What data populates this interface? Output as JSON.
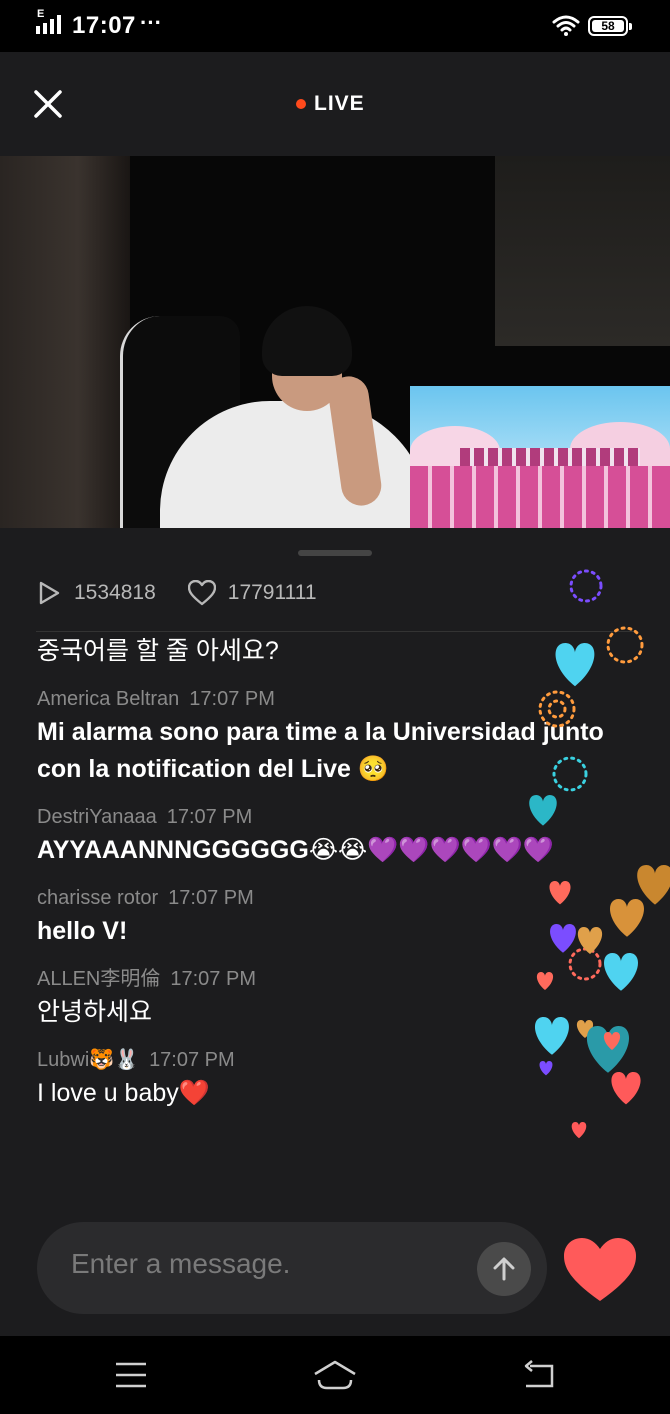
{
  "status_bar": {
    "network_label": "E",
    "time": "17:07",
    "more_dots": "···",
    "battery_level": "58"
  },
  "header": {
    "live_label": "LIVE",
    "accent_color": "#ff4a1c"
  },
  "stats": {
    "plays": "1534818",
    "likes": "17791111"
  },
  "chat": {
    "first_message": "중국어를 할 줄 아세요?",
    "messages": [
      {
        "user": "America Beltran",
        "time": "17:07 PM",
        "text": "Mi alarma sono para time a la Universidad junto con la notification del Live 🥺"
      },
      {
        "user": "DestriYanaaa",
        "time": "17:07 PM",
        "text": "AYYAAANNNGGGGGG😭😭💜💜💜💜💜💜"
      },
      {
        "user": "charisse rotor",
        "time": "17:07 PM",
        "text": "hello V!"
      },
      {
        "user": "ALLEN李明倫",
        "time": "17:07 PM",
        "text": "안녕하세요"
      },
      {
        "user": "Lubwi🐯🐰",
        "time": "17:07 PM",
        "text": "I love u baby❤️"
      }
    ]
  },
  "input": {
    "placeholder": "Enter a message."
  },
  "icons": {
    "close": "close-icon",
    "send": "arrow-up-icon",
    "like": "heart-icon",
    "play": "play-icon",
    "likes": "heart-outline-icon"
  },
  "colors": {
    "progress": "#2fd3c3",
    "like_button": "#ff5a5a"
  }
}
